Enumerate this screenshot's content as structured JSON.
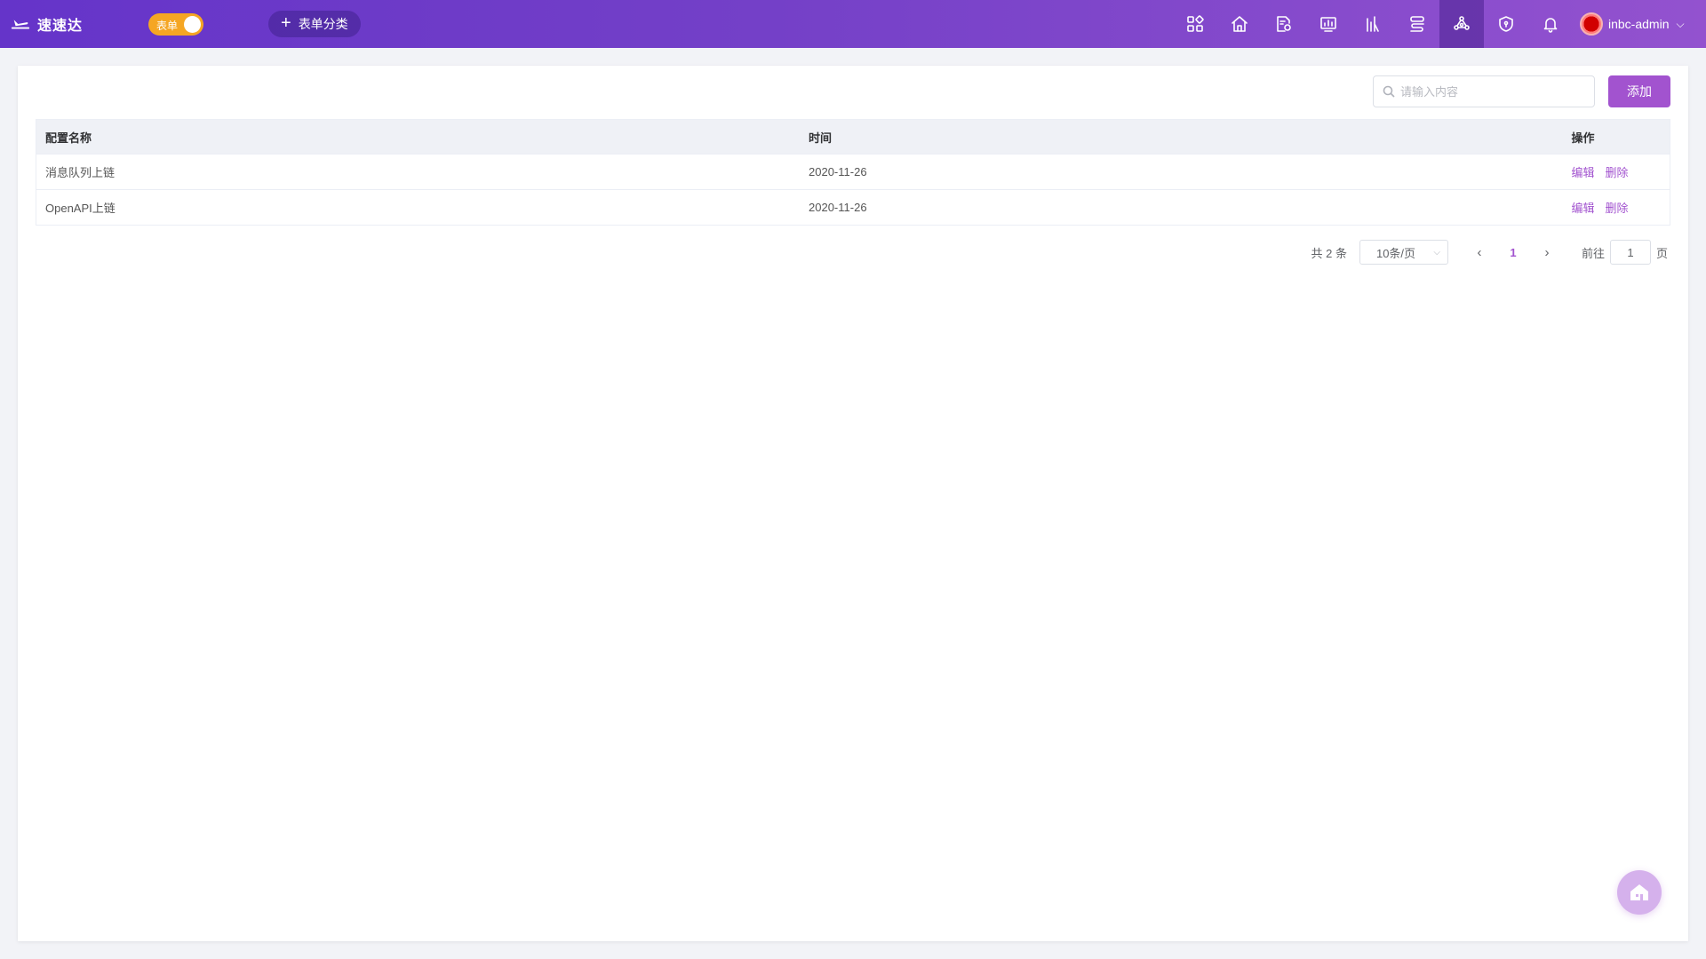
{
  "header": {
    "brand": "速速达",
    "mode_switch_label": "表单",
    "category_button_label": "表单分类",
    "nav_icons": [
      "apps-icon",
      "home-icon",
      "document-settings-icon",
      "monitor-chart-icon",
      "bar-chart-icon",
      "flow-icon",
      "network-icon",
      "shield-icon",
      "bell-icon"
    ],
    "active_nav_icon": "network-icon",
    "user_name": "inbc-admin"
  },
  "toolbar": {
    "search_placeholder": "请输入内容",
    "search_value": "",
    "add_label": "添加"
  },
  "table": {
    "columns": [
      "配置名称",
      "时间",
      "操作"
    ],
    "rows": [
      {
        "name": "消息队列上链",
        "time": "2020-11-26",
        "edit": "编辑",
        "delete": "删除"
      },
      {
        "name": "OpenAPI上链",
        "time": "2020-11-26",
        "edit": "编辑",
        "delete": "删除"
      }
    ]
  },
  "pagination": {
    "total": "共 2 条",
    "page_size": "10条/页",
    "current_page": "1",
    "goto_prefix": "前往",
    "goto_value": "1",
    "goto_suffix": "页"
  },
  "colors": {
    "accent": "#a253cf",
    "topbar_start": "#6534c9",
    "topbar_end": "#9352cf",
    "switch": "#f5a623"
  }
}
